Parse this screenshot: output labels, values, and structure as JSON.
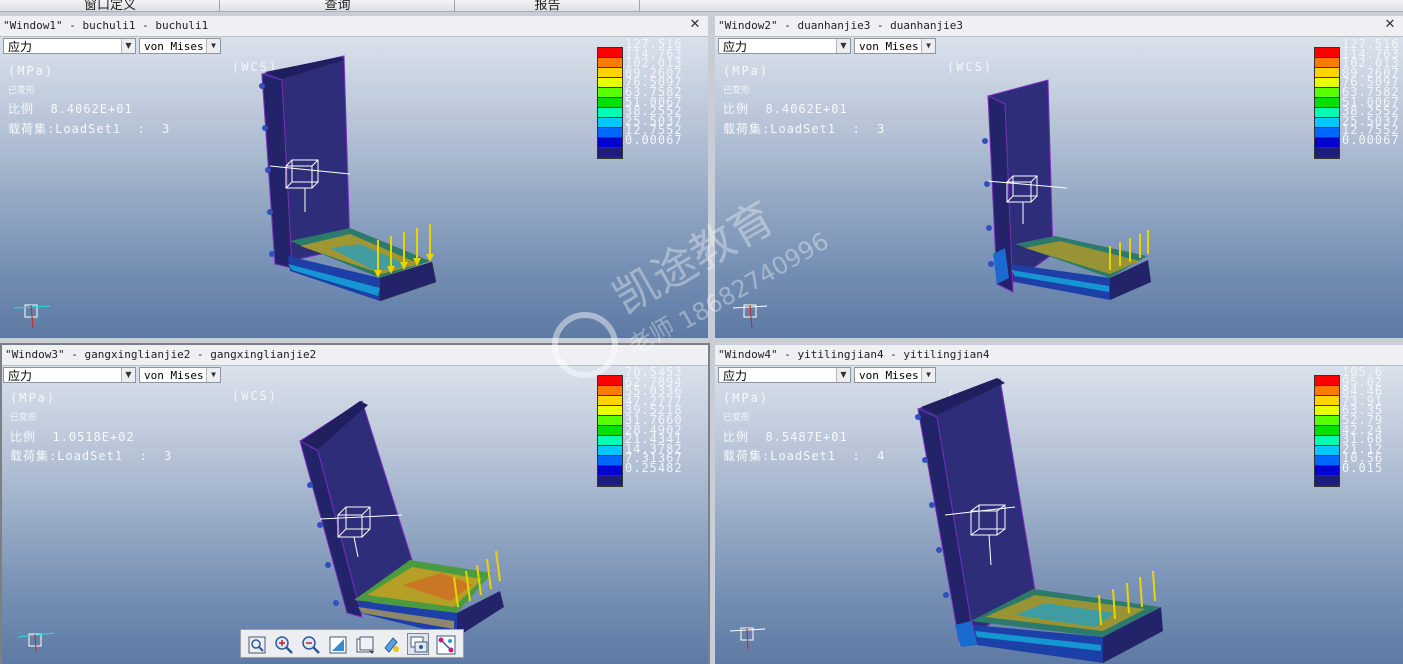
{
  "menubar": {
    "items": [
      "窗口定义",
      "查询",
      "报告"
    ]
  },
  "windows": [
    {
      "title": "\"Window1\" - buchuli1 - buchuli1",
      "quantity": "应力",
      "component": "von Mises",
      "wcs": "(WCS)",
      "units": "(MPa)",
      "deformed": "已变形",
      "scale_line": "比例  8.4062E+01",
      "load_line": "载荷集:LoadSet1  :  3",
      "legend_values": [
        "127.516",
        "114.763",
        "102.013",
        "89.2607",
        "76.5097",
        "63.7582",
        "51.0067",
        "38.2552",
        "25.5037",
        "12.7552",
        "0.00067"
      ]
    },
    {
      "title": "\"Window2\" - duanhanjie3 - duanhanjie3",
      "quantity": "应力",
      "component": "von Mises",
      "wcs": "(WCS)",
      "units": "(MPa)",
      "deformed": "已变形",
      "scale_line": "比例  8.4062E+01",
      "load_line": "载荷集:LoadSet1  :  3",
      "legend_values": [
        "127.516",
        "114.763",
        "102.013",
        "89.2607",
        "76.5097",
        "63.7582",
        "51.0067",
        "38.2552",
        "25.5037",
        "12.7552",
        "0.00067"
      ]
    },
    {
      "title": "\"Window3\" - gangxinglianjie2 - gangxinglianjie2",
      "quantity": "应力",
      "component": "von Mises",
      "wcs": "(WCS)",
      "units": "(MPa)",
      "deformed": "已变形",
      "scale_line": "比例  1.0518E+02",
      "load_line": "载荷集:LoadSet1  :  3",
      "legend_values": [
        "70.5453",
        "62.7894",
        "55.0336",
        "47.2777",
        "39.5218",
        "31.7660",
        "28.4902",
        "21.4341",
        "14.3782",
        "7.31367",
        "0.25482"
      ]
    },
    {
      "title": "\"Window4\" - yitilingjian4 - yitilingjian4",
      "quantity": "应力",
      "component": "von Mises",
      "wcs": "(WCS)",
      "units": "(MPa)",
      "deformed": "已变形",
      "scale_line": "比例  8.5487E+01",
      "load_line": "载荷集:LoadSet1  :  4",
      "legend_values": [
        "105.6",
        "95.02",
        "84.46",
        "73.91",
        "63.35",
        "52.79",
        "42.24",
        "31.68",
        "21.12",
        "10.56",
        "0.015"
      ]
    }
  ],
  "legend_colors": [
    "#ff0000",
    "#ff7a00",
    "#ffd400",
    "#e8ff00",
    "#58ff00",
    "#00e000",
    "#00ffb0",
    "#00c8ff",
    "#0068ff",
    "#0000d0",
    "#1c1c7a"
  ],
  "toolbar": {
    "buttons": [
      "refit-icon",
      "zoom-in-icon",
      "zoom-out-icon",
      "repaint-icon",
      "display-style-icon",
      "named-views-icon",
      "view-manager-icon",
      "datum-display-icon"
    ]
  },
  "watermark": {
    "brand": "凯途教育",
    "phone": "18682740996",
    "teacher": "老师"
  }
}
